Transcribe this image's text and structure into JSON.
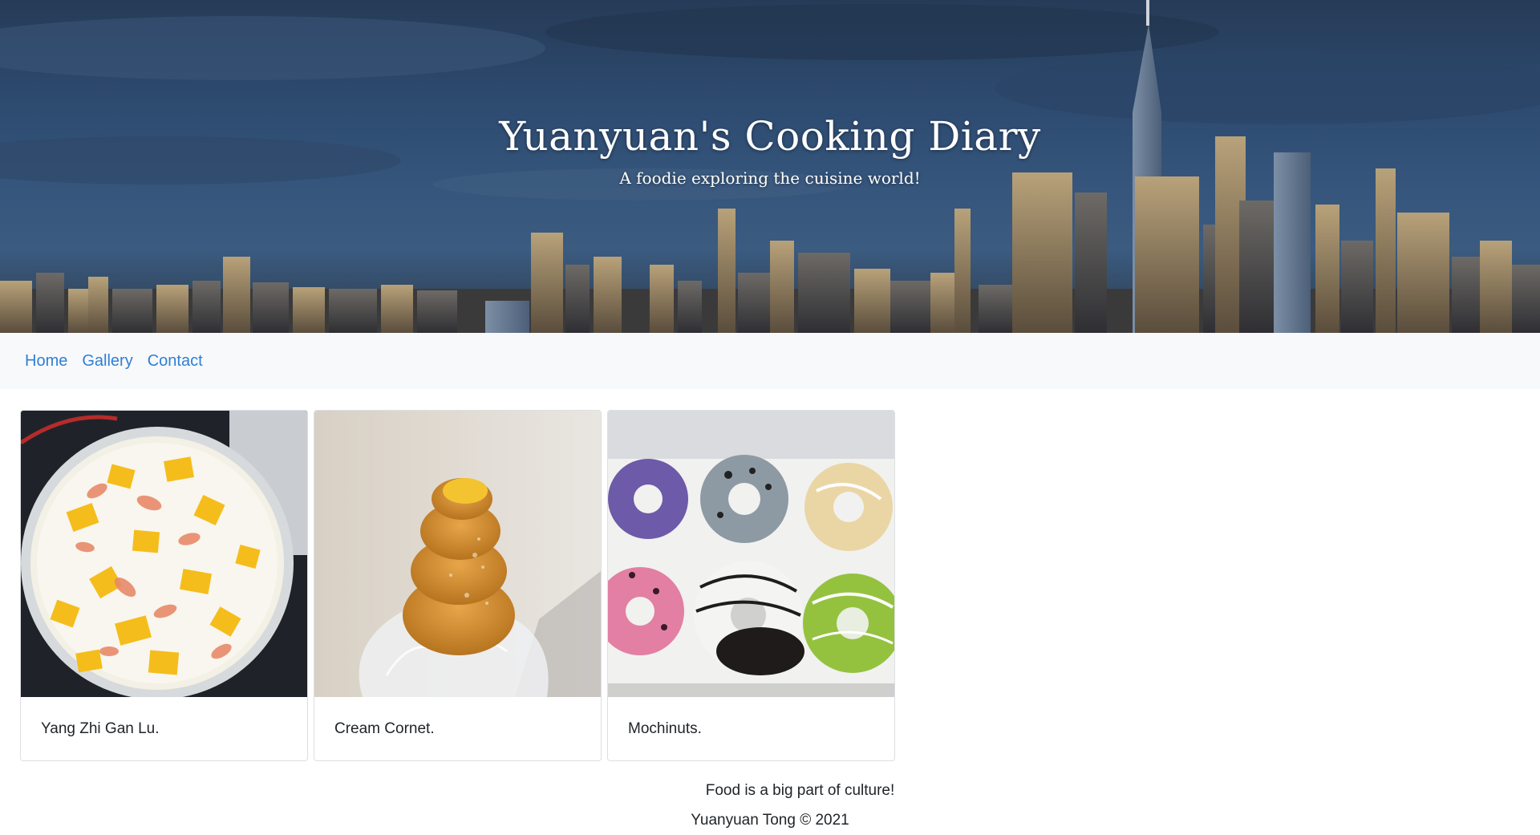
{
  "header": {
    "title": "Yuanyuan's Cooking Diary",
    "subtitle": "A foodie exploring the cuisine world!"
  },
  "nav": {
    "items": [
      {
        "label": "Home"
      },
      {
        "label": "Gallery"
      },
      {
        "label": "Contact"
      }
    ],
    "link_color": "#2f7fd6"
  },
  "cards": [
    {
      "caption": "Yang Zhi Gan Lu.",
      "image": "mango-pomelo-dessert-photo"
    },
    {
      "caption": "Cream Cornet.",
      "image": "cream-cornet-pastry-photo"
    },
    {
      "caption": "Mochinuts.",
      "image": "mochi-donuts-box-photo"
    }
  ],
  "footer": {
    "tagline": "Food is a big part of culture!",
    "copyright": "Yuanyuan Tong © 2021"
  }
}
